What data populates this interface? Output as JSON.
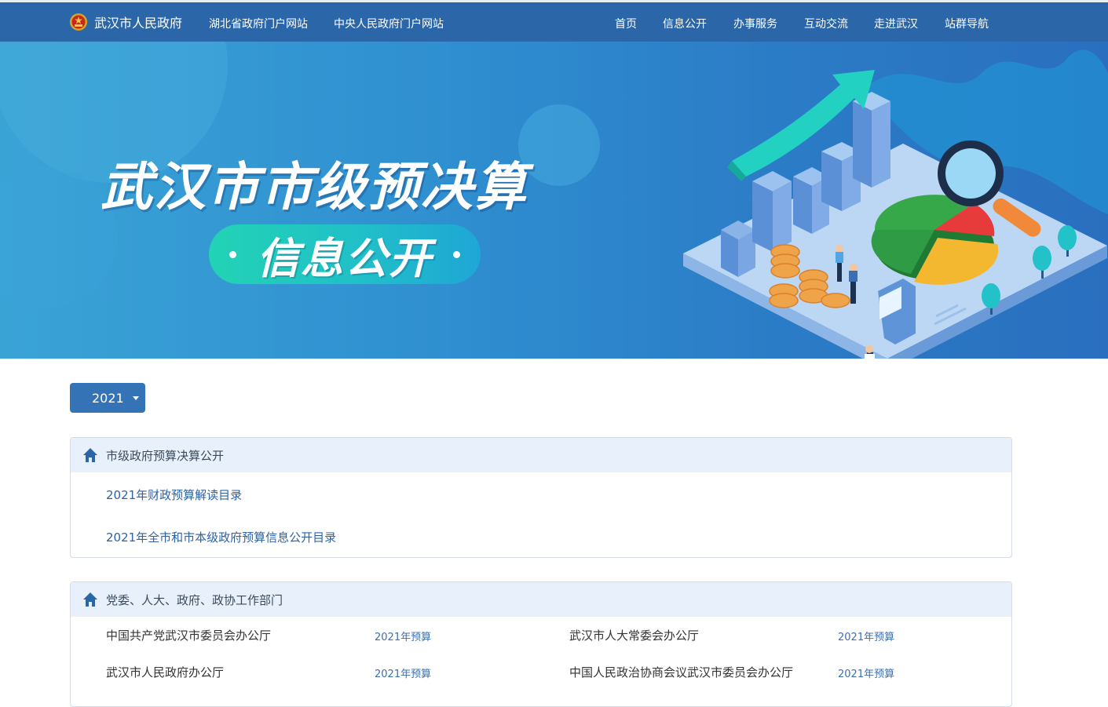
{
  "header": {
    "site_name": "武汉市人民政府",
    "links": [
      "湖北省政府门户网站",
      "中央人民政府门户网站"
    ],
    "nav": [
      "首页",
      "信息公开",
      "办事服务",
      "互动交流",
      "走进武汉",
      "站群导航"
    ]
  },
  "banner": {
    "title": "武汉市市级预决算",
    "subtitle": "信息公开"
  },
  "year_selector": {
    "value": "2021"
  },
  "panels": [
    {
      "title": "市级政府预算决算公开",
      "links": [
        "2021年财政预算解读目录",
        "2021年全市和市本级政府预算信息公开目录"
      ]
    },
    {
      "title": "党委、人大、政府、政协工作部门",
      "rows": [
        {
          "left": "中国共产党武汉市委员会办公厅",
          "left_link": "2021年预算",
          "right": "武汉市人大常委会办公厅",
          "right_link": "2021年预算"
        },
        {
          "left": "武汉市人民政府办公厅",
          "left_link": "2021年预算",
          "right": "中国人民政治协商会议武汉市委员会办公厅",
          "right_link": "2021年预算"
        }
      ]
    }
  ],
  "colors": {
    "nav_bg": "#2b66a8",
    "accent": "#3473b6",
    "panel_head_bg": "#e8f1fb",
    "link": "#2d62a6"
  }
}
